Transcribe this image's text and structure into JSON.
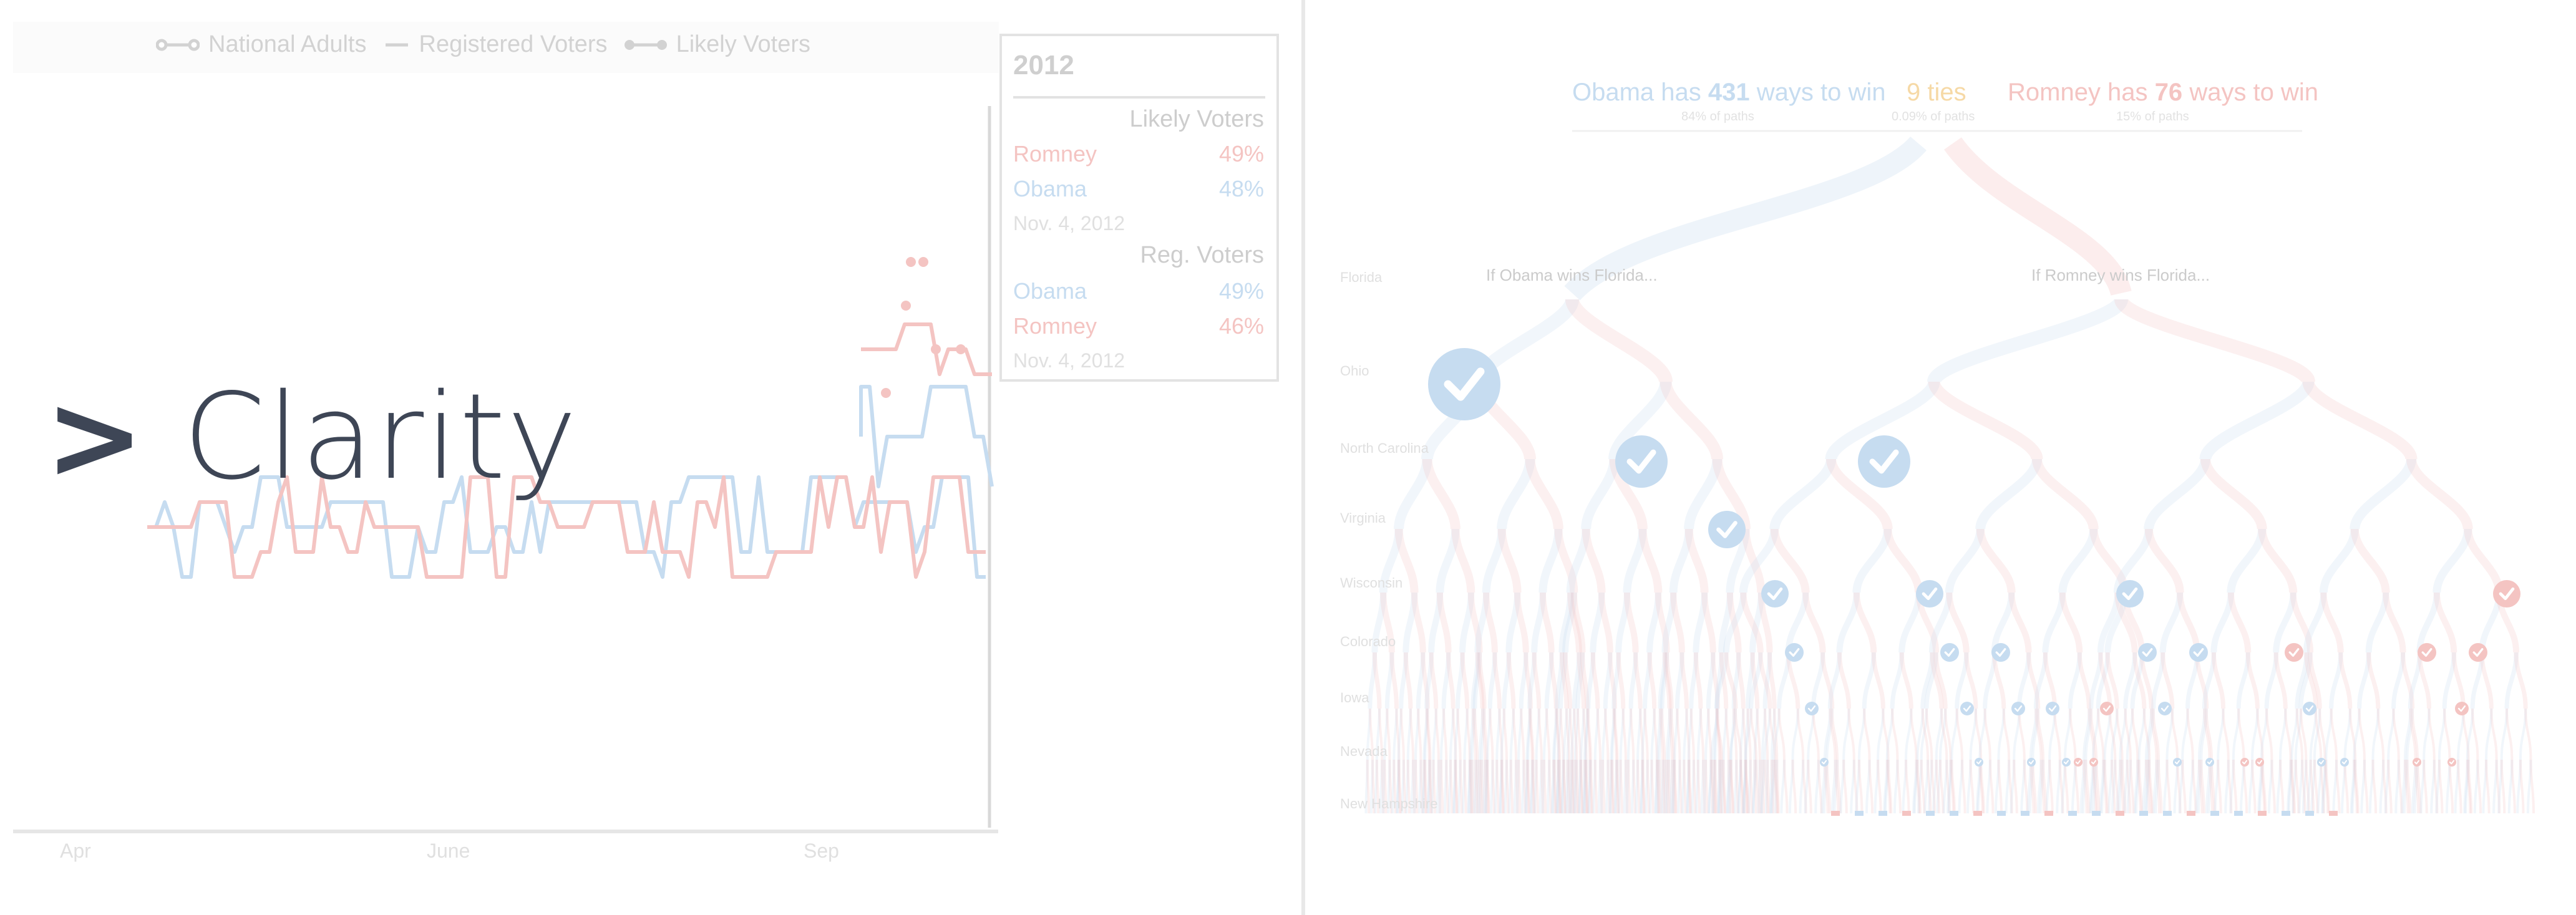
{
  "legend": {
    "national": "National Adults",
    "registered": "Registered Voters",
    "likely": "Likely Voters"
  },
  "tooltip": {
    "year": "2012",
    "likely_header": "Likely Voters",
    "likely_rows": [
      {
        "name": "Romney",
        "value": "49%"
      },
      {
        "name": "Obama",
        "value": "48%"
      }
    ],
    "likely_date": "Nov. 4, 2012",
    "reg_header": "Reg. Voters",
    "reg_rows": [
      {
        "name": "Obama",
        "value": "49%"
      },
      {
        "name": "Romney",
        "value": "46%"
      }
    ],
    "reg_date": "Nov. 4, 2012"
  },
  "x_ticks": [
    "Apr",
    "June",
    "Sep"
  ],
  "overlay": {
    "chevron": ">",
    "title": "Clarity"
  },
  "tree": {
    "obama_text_pre": "Obama has",
    "obama_ways": "431",
    "obama_text_post": "ways to win",
    "obama_sub": "84% of paths",
    "ties": "9 ties",
    "ties_sub": "0.09% of paths",
    "romney_text_pre": "Romney has",
    "romney_ways": "76",
    "romney_text_post": "ways to win",
    "romney_sub": "15% of paths",
    "branch_left": "If Obama wins Florida...",
    "branch_right": "If Romney wins Florida...",
    "states": [
      "Florida",
      "Ohio",
      "North Carolina",
      "Virginia",
      "Wisconsin",
      "Colorado",
      "Iowa",
      "Nevada",
      "New Hampshire"
    ]
  },
  "colors": {
    "romney": "#f4c4c2",
    "obama": "#c6dcf0",
    "ties": "#f6d9a6",
    "title": "#3e4656"
  },
  "icons": {
    "check": "check-circle-icon"
  }
}
